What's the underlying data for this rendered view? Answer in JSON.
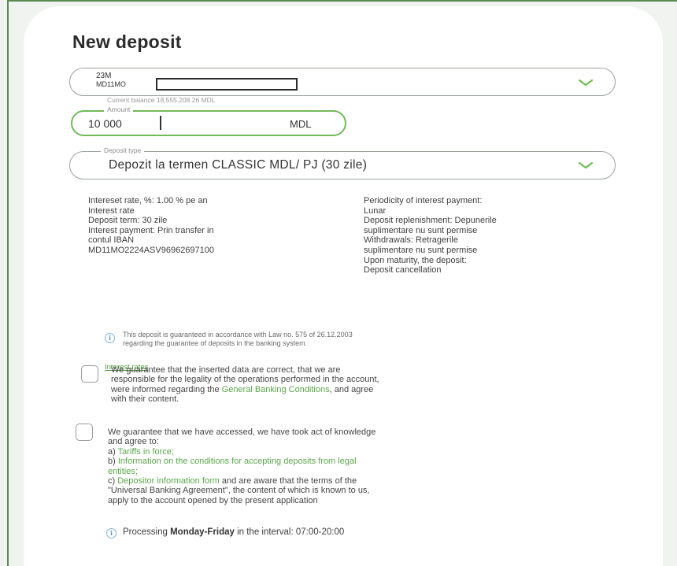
{
  "form": {
    "title": "New deposit",
    "account": {
      "name": "23M",
      "code": "MD11MO",
      "balance_text": "Current balance 18,555,208.26 MDL"
    },
    "amount": {
      "label": "Amount",
      "value": "10 000",
      "currency": "MDL"
    },
    "deposit_type": {
      "label": "Deposit type",
      "value": "Depozit la termen CLASSIC MDL/ PJ (30 zile)"
    }
  },
  "details": {
    "left": [
      "Intereset rate, %: 1.00 % pe an",
      "Interest rate",
      "Deposit term: 30 zile",
      "Interest payment: Prin transfer in",
      "contul IBAN",
      "MD11MO2224ASV96962697100"
    ],
    "right": [
      "Periodicity of interest payment:",
      "Lunar",
      "Deposit replenishment: Depunerile",
      "suplimentare nu sunt permise",
      "Withdrawals: Retragerile",
      "suplimentare nu sunt permise",
      "Upon maturity, the deposit:",
      "Deposit cancellation"
    ]
  },
  "guarantee_note": {
    "line1": "This deposit is guaranteed in accordance with Law no. 575 of 26.12.2003",
    "line2": "regarding the guarantee of deposits in the banking system."
  },
  "links": {
    "interest_rates": "Interest rates"
  },
  "agreement1": {
    "line1": "We guarantee that the inserted data are correct, that we are",
    "line2": "responsible for the legality of the operations performed in the account,",
    "line3_pre": "were informed regarding the ",
    "line3_link": "General Banking Conditions",
    "line3_post": ", and agree",
    "line4": "with their content."
  },
  "agreement2": {
    "line1": "We guarantee that we have accessed, we have took act of knowledge",
    "line2": "and agree to:",
    "a_prefix": "a) ",
    "a_link": "Tariffs in force;",
    "b_prefix": "b) ",
    "b_link1": "Information on the conditions for accepting deposits from legal",
    "b_link2": "entities;",
    "c_prefix": "c) ",
    "c_link": "Depositor information form",
    "c_post": " and are aware that the terms of the",
    "line_d": "\"Universal Banking Agreement\", the content of which is known to us,",
    "line_e": "apply to the account opened by the present application"
  },
  "processing": {
    "pre": "Processing ",
    "bold": "Monday-Friday",
    "post": " in the interval: 07:00-20:00"
  },
  "colors": {
    "accent_green": "#5aa74a",
    "info_blue": "#5a9ac8"
  }
}
